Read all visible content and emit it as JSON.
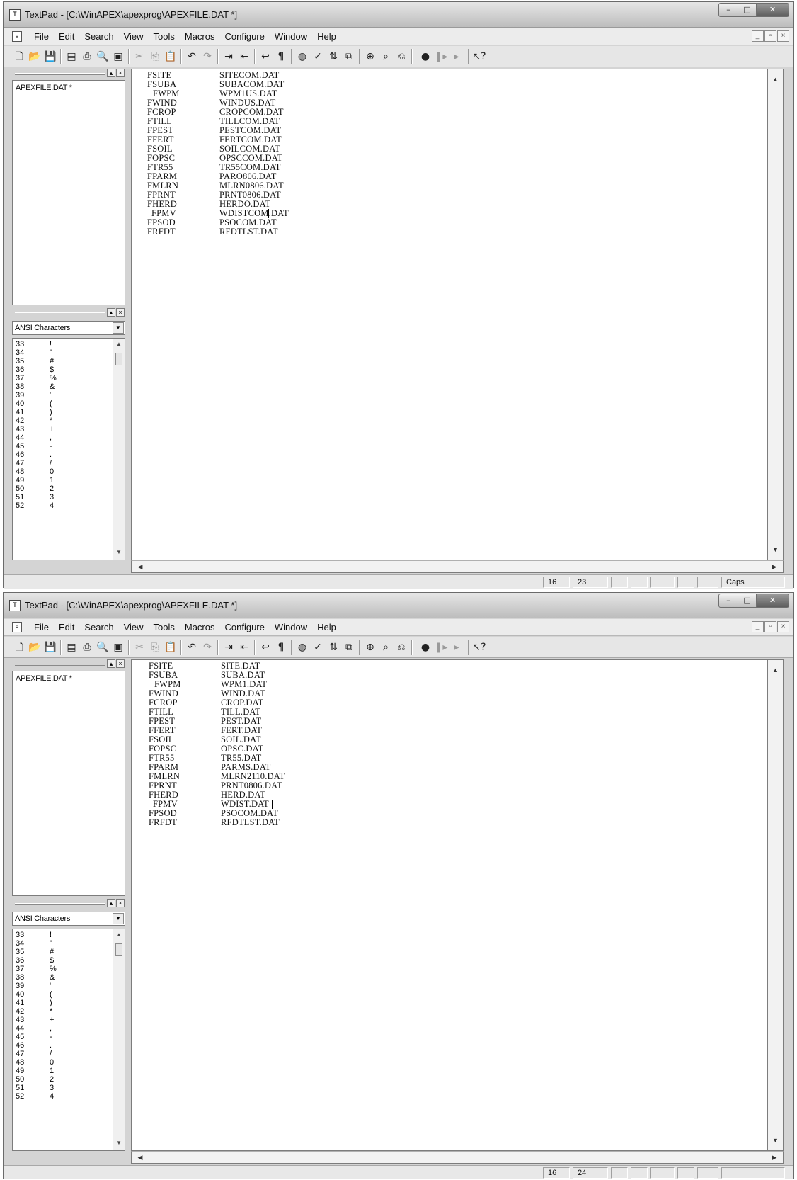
{
  "windows": [
    {
      "title": "TextPad - [C:\\WinAPEX\\apexprog\\APEXFILE.DAT *]",
      "menu": [
        "File",
        "Edit",
        "Search",
        "View",
        "Tools",
        "Macros",
        "Configure",
        "Window",
        "Help"
      ],
      "open_documents": [
        "APEXFILE.DAT *"
      ],
      "ansi_panel": {
        "selected": "ANSI Characters",
        "rows": [
          {
            "code": "33",
            "char": "!"
          },
          {
            "code": "34",
            "char": "\""
          },
          {
            "code": "35",
            "char": "#"
          },
          {
            "code": "36",
            "char": "$"
          },
          {
            "code": "37",
            "char": "%"
          },
          {
            "code": "38",
            "char": "&"
          },
          {
            "code": "39",
            "char": "'"
          },
          {
            "code": "40",
            "char": "("
          },
          {
            "code": "41",
            "char": ")"
          },
          {
            "code": "42",
            "char": "*"
          },
          {
            "code": "43",
            "char": "+"
          },
          {
            "code": "44",
            "char": ","
          },
          {
            "code": "45",
            "char": "-"
          },
          {
            "code": "46",
            "char": "."
          },
          {
            "code": "47",
            "char": "/"
          },
          {
            "code": "48",
            "char": "0"
          },
          {
            "code": "49",
            "char": "1"
          },
          {
            "code": "50",
            "char": "2"
          },
          {
            "code": "51",
            "char": "3"
          },
          {
            "code": "52",
            "char": "4"
          }
        ]
      },
      "lines": [
        {
          "key": "FSITE",
          "value": "SITECOM.DAT"
        },
        {
          "key": "FSUBA",
          "value": "SUBACOM.DAT"
        },
        {
          "key": "FWPM",
          "value": "WPM1US.DAT"
        },
        {
          "key": "FWIND",
          "value": "WINDUS.DAT"
        },
        {
          "key": "FCROP",
          "value": "CROPCOM.DAT"
        },
        {
          "key": "FTILL",
          "value": "TILLCOM.DAT"
        },
        {
          "key": "FPEST",
          "value": "PESTCOM.DAT"
        },
        {
          "key": "FFERT",
          "value": "FERTCOM.DAT"
        },
        {
          "key": "FSOIL",
          "value": "SOILCOM.DAT"
        },
        {
          "key": "FOPSC",
          "value": "OPSCCOM.DAT"
        },
        {
          "key": "FTR55",
          "value": "TR55COM.DAT"
        },
        {
          "key": "FPARM",
          "value": "PARO806.DAT"
        },
        {
          "key": "FMLRN",
          "value": "MLRN0806.DAT"
        },
        {
          "key": "FPRNT",
          "value": "PRNT0806.DAT"
        },
        {
          "key": "FHERD",
          "value": "HERDO.DAT"
        },
        {
          "key": "FPMV",
          "value": "WDISTCOM.DAT"
        },
        {
          "key": "FPSOD",
          "value": "PSOCOM.DAT"
        },
        {
          "key": "FRFDT",
          "value": "RFDTLST.DAT"
        }
      ],
      "status": {
        "line": "16",
        "col": "23",
        "caps": "Caps"
      }
    },
    {
      "title": "TextPad - [C:\\WinAPEX\\apexprog\\APEXFILE.DAT *]",
      "menu": [
        "File",
        "Edit",
        "Search",
        "View",
        "Tools",
        "Macros",
        "Configure",
        "Window",
        "Help"
      ],
      "open_documents": [
        "APEXFILE.DAT *"
      ],
      "ansi_panel": {
        "selected": "ANSI Characters",
        "rows": [
          {
            "code": "33",
            "char": "!"
          },
          {
            "code": "34",
            "char": "\""
          },
          {
            "code": "35",
            "char": "#"
          },
          {
            "code": "36",
            "char": "$"
          },
          {
            "code": "37",
            "char": "%"
          },
          {
            "code": "38",
            "char": "&"
          },
          {
            "code": "39",
            "char": "'"
          },
          {
            "code": "40",
            "char": "("
          },
          {
            "code": "41",
            "char": ")"
          },
          {
            "code": "42",
            "char": "*"
          },
          {
            "code": "43",
            "char": "+"
          },
          {
            "code": "44",
            "char": ","
          },
          {
            "code": "45",
            "char": "-"
          },
          {
            "code": "46",
            "char": "."
          },
          {
            "code": "47",
            "char": "/"
          },
          {
            "code": "48",
            "char": "0"
          },
          {
            "code": "49",
            "char": "1"
          },
          {
            "code": "50",
            "char": "2"
          },
          {
            "code": "51",
            "char": "3"
          },
          {
            "code": "52",
            "char": "4"
          }
        ]
      },
      "lines": [
        {
          "key": "FSITE",
          "value": "SITE.DAT"
        },
        {
          "key": "FSUBA",
          "value": "SUBA.DAT"
        },
        {
          "key": "FWPM",
          "value": "WPM1.DAT"
        },
        {
          "key": "FWIND",
          "value": "WIND.DAT"
        },
        {
          "key": "FCROP",
          "value": "CROP.DAT"
        },
        {
          "key": "FTILL",
          "value": "TILL.DAT"
        },
        {
          "key": "FPEST",
          "value": "PEST.DAT"
        },
        {
          "key": "FFERT",
          "value": "FERT.DAT"
        },
        {
          "key": "FSOIL",
          "value": "SOIL.DAT"
        },
        {
          "key": "FOPSC",
          "value": "OPSC.DAT"
        },
        {
          "key": "FTR55",
          "value": "TR55.DAT"
        },
        {
          "key": "FPARM",
          "value": "PARMS.DAT"
        },
        {
          "key": "FMLRN",
          "value": "MLRN2110.DAT"
        },
        {
          "key": "FPRNT",
          "value": "PRNT0806.DAT"
        },
        {
          "key": "FHERD",
          "value": "HERD.DAT"
        },
        {
          "key": "FPMV",
          "value": "WDIST.DAT"
        },
        {
          "key": "FPSOD",
          "value": "PSOCOM.DAT"
        },
        {
          "key": "FRFDT",
          "value": "RFDTLST.DAT"
        }
      ],
      "status": {
        "line": "16",
        "col": "24",
        "caps": ""
      }
    }
  ]
}
